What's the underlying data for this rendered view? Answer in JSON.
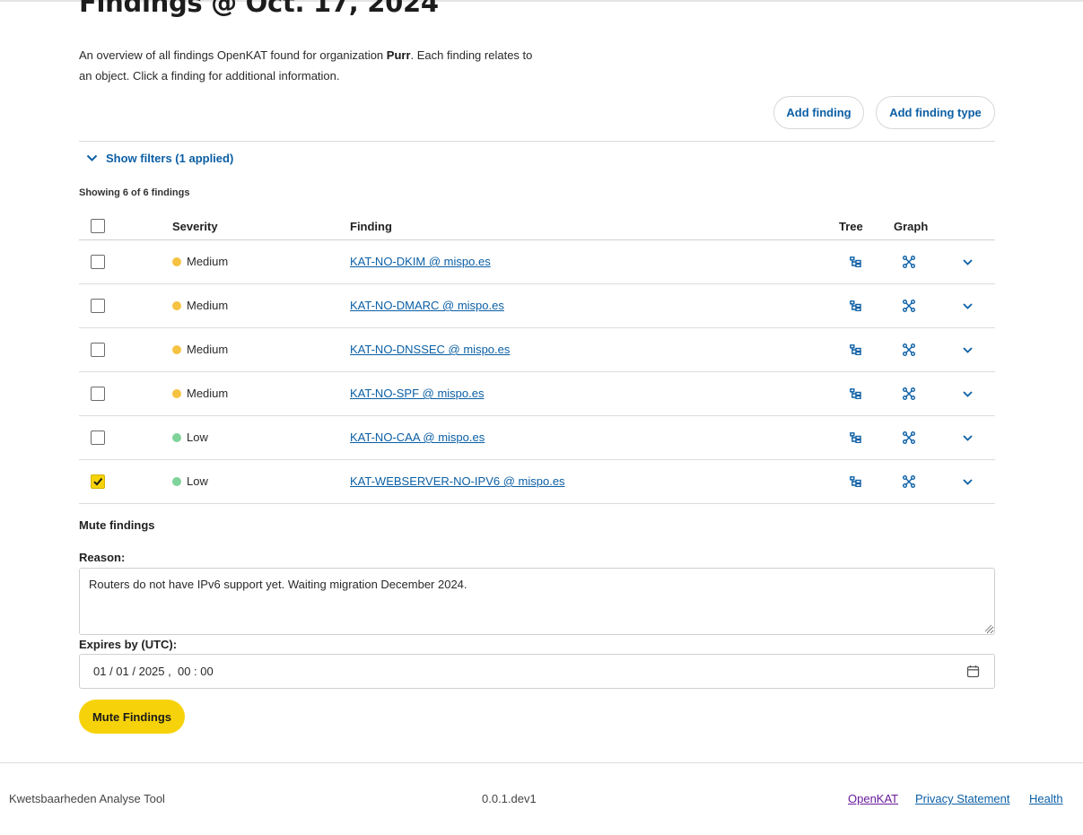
{
  "page": {
    "title": "Findings @ Oct. 17, 2024",
    "intro_prefix": "An overview of all findings OpenKAT found for organization ",
    "organization": "Purr",
    "intro_suffix": ". Each finding relates to an object. Click a finding for additional information."
  },
  "actions": {
    "add_finding": "Add finding",
    "add_finding_type": "Add finding type"
  },
  "filters": {
    "toggle_label": "Show filters (1 applied)"
  },
  "summary": "Showing 6 of 6 findings",
  "table": {
    "headers": {
      "severity": "Severity",
      "finding": "Finding",
      "tree": "Tree",
      "graph": "Graph"
    },
    "rows": [
      {
        "severity": "Medium",
        "finding": "KAT-NO-DKIM @ mispo.es",
        "checked": false
      },
      {
        "severity": "Medium",
        "finding": "KAT-NO-DMARC @ mispo.es",
        "checked": false
      },
      {
        "severity": "Medium",
        "finding": "KAT-NO-DNSSEC @ mispo.es",
        "checked": false
      },
      {
        "severity": "Medium",
        "finding": "KAT-NO-SPF @ mispo.es",
        "checked": false
      },
      {
        "severity": "Low",
        "finding": "KAT-NO-CAA @ mispo.es",
        "checked": false
      },
      {
        "severity": "Low",
        "finding": "KAT-WEBSERVER-NO-IPV6 @ mispo.es",
        "checked": true
      }
    ]
  },
  "severity_colors": {
    "Medium": "#f5c242",
    "Low": "#7ed39a"
  },
  "colors": {
    "accent": "#f6d20a",
    "link": "#0b5fa5"
  },
  "mute": {
    "title": "Mute findings",
    "reason_label": "Reason:",
    "reason_value": "Routers do not have IPv6 support yet. Waiting migration December 2024.",
    "expires_label": "Expires by (UTC):",
    "expires_value": "01 / 01 / 2025 ,  00 : 00",
    "submit": "Mute Findings"
  },
  "footer": {
    "app_name": "Kwetsbaarheden Analyse Tool",
    "version": "0.0.1.dev1",
    "links": [
      "OpenKAT",
      "Privacy Statement",
      "Health"
    ]
  },
  "icons": {
    "filters_toggle": "chevron-down-icon",
    "tree": "tree-icon",
    "graph": "graph-icon",
    "row_expand": "chevron-down-icon",
    "calendar": "calendar-icon"
  }
}
